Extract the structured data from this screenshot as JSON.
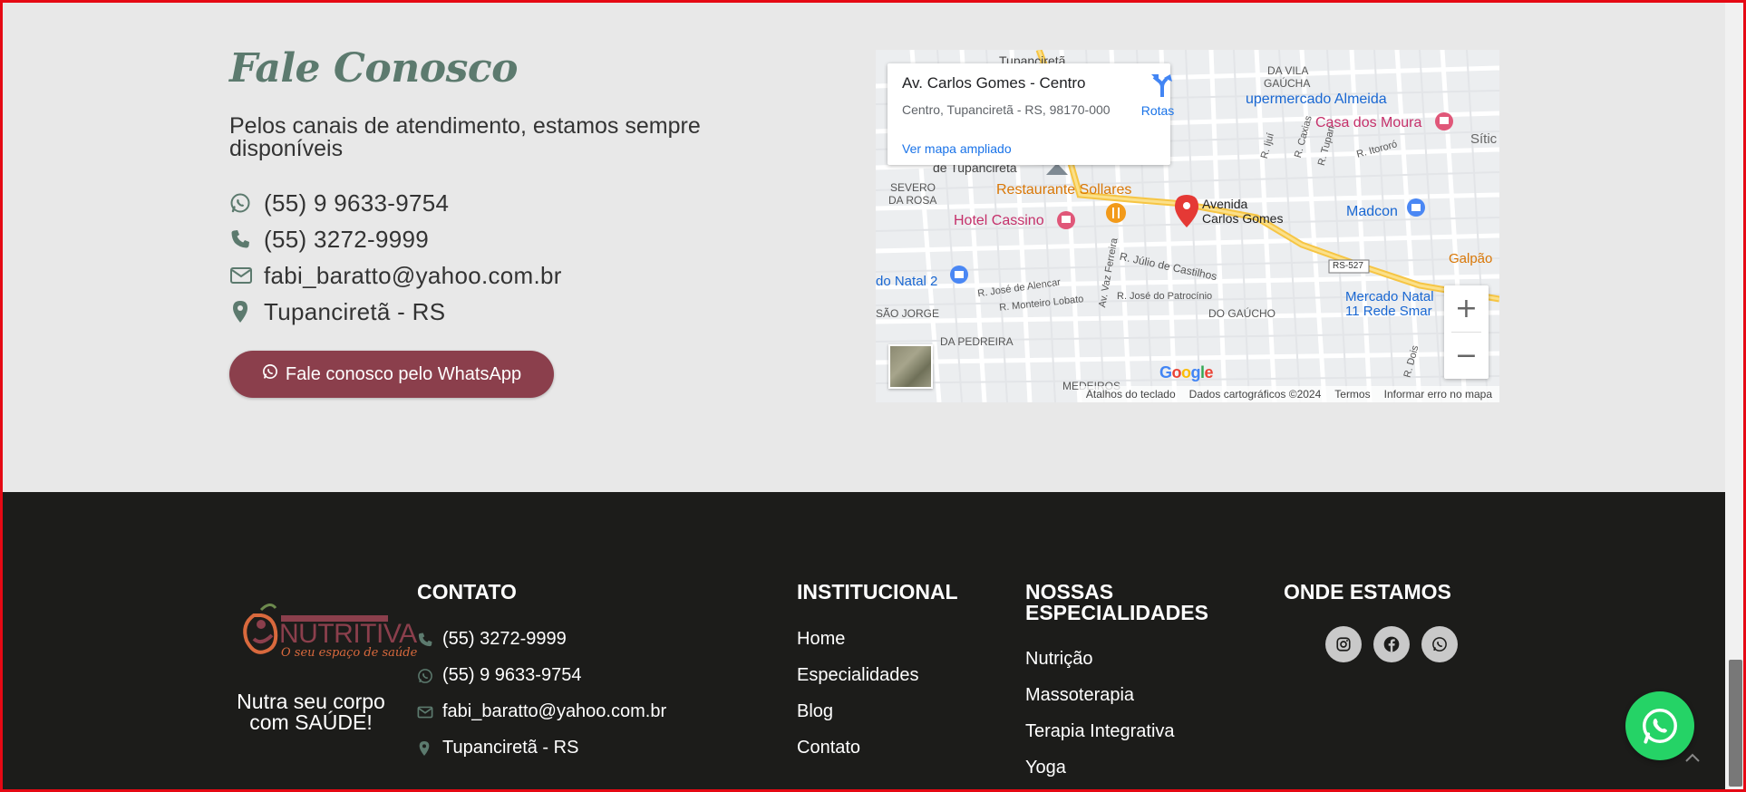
{
  "contact": {
    "title": "Fale Conosco",
    "subtitle": "Pelos canais de atendimento, estamos sempre disponíveis",
    "items": [
      {
        "icon": "whatsapp-icon",
        "text": "(55) 9 9633-9754"
      },
      {
        "icon": "phone-icon",
        "text": "(55) 3272-9999"
      },
      {
        "icon": "envelope-icon",
        "text": "fabi_baratto@yahoo.com.br"
      },
      {
        "icon": "map-marker-icon",
        "text": "Tupanciretã - RS"
      }
    ],
    "whatsapp_button": "Fale conosco pelo WhatsApp"
  },
  "map": {
    "place_name": "Av. Carlos Gomes - Centro",
    "address": "Centro, Tupanciretã - RS, 98170-000",
    "view_larger": "Ver mapa ampliado",
    "directions": "Rotas",
    "zoom_in": "+",
    "zoom_out": "−",
    "google": "Google",
    "attribution": [
      "Atalhos do teclado",
      "Dados cartográficos ©2024",
      "Termos",
      "Informar erro no mapa"
    ],
    "labels": {
      "tupancireta": "Tupanciretã",
      "vila_gaucha_1": "DA VILA",
      "vila_gaucha_2": "GAÚCHA",
      "supermercado": "upermercado Almeida",
      "casa_moura": "Casa dos Moura",
      "sitio": "Sític",
      "ijui": "R. Ijuí",
      "caxias": "R. Caxias",
      "tupan": "R. Tupan",
      "itororo": "R. Itororó",
      "de_tupancireta": "de Tupanciretã",
      "severo_1": "SEVERO",
      "severo_2": "DA ROSA",
      "restaurante": "Restaurante Sollares",
      "avenida_1": "Avenida",
      "avenida_2": "Carlos Gomes",
      "hotel": "Hotel Cassino",
      "madcon": "Madcon",
      "vaz_ferreira": "Av. Vaz Ferreira",
      "julio": "R. Júlio de Castilhos",
      "rs527": "RS-527",
      "galpao": "Galpão",
      "natal": "do Natal 2",
      "alencar": "R. José de Alencar",
      "patrocinio": "R. José do Patrocínio",
      "mercado_1": "Mercado Natal",
      "mercado_2": "11 Rede Smar",
      "lobato": "R. Monteiro Lobato",
      "sao_jorge": "SÃO JORGE",
      "do_gaucho": "DO GAÚCHO",
      "pedreira": "DA PEDREIRA",
      "dois": "R. Dois",
      "medeiros": "MEDEIROS"
    }
  },
  "footer": {
    "logo_text": "NUTRITIVA",
    "logo_tagline": "O seu espaço de saúde",
    "slogan": "Nutra seu corpo com SAÚDE!",
    "contato": {
      "heading": "CONTATO",
      "items": [
        {
          "icon": "phone-icon",
          "text": "(55) 3272-9999"
        },
        {
          "icon": "whatsapp-icon",
          "text": "(55) 9 9633-9754"
        },
        {
          "icon": "envelope-icon",
          "text": "fabi_baratto@yahoo.com.br"
        },
        {
          "icon": "map-marker-icon",
          "text": "Tupanciretã - RS"
        }
      ]
    },
    "institucional": {
      "heading": "INSTITUCIONAL",
      "links": [
        "Home",
        "Especialidades",
        "Blog",
        "Contato"
      ]
    },
    "especialidades": {
      "heading": "NOSSAS ESPECIALIDADES",
      "links": [
        "Nutrição",
        "Massoterapia",
        "Terapia Integrativa",
        "Yoga"
      ]
    },
    "onde": {
      "heading": "ONDE ESTAMOS",
      "social": [
        "instagram-icon",
        "facebook-icon",
        "whatsapp-icon"
      ]
    }
  },
  "colors": {
    "accent_green": "#5c7a6e",
    "button_wine": "#8b3f4c",
    "footer_bg": "#1c1c1a",
    "whatsapp_green": "#25d366"
  }
}
